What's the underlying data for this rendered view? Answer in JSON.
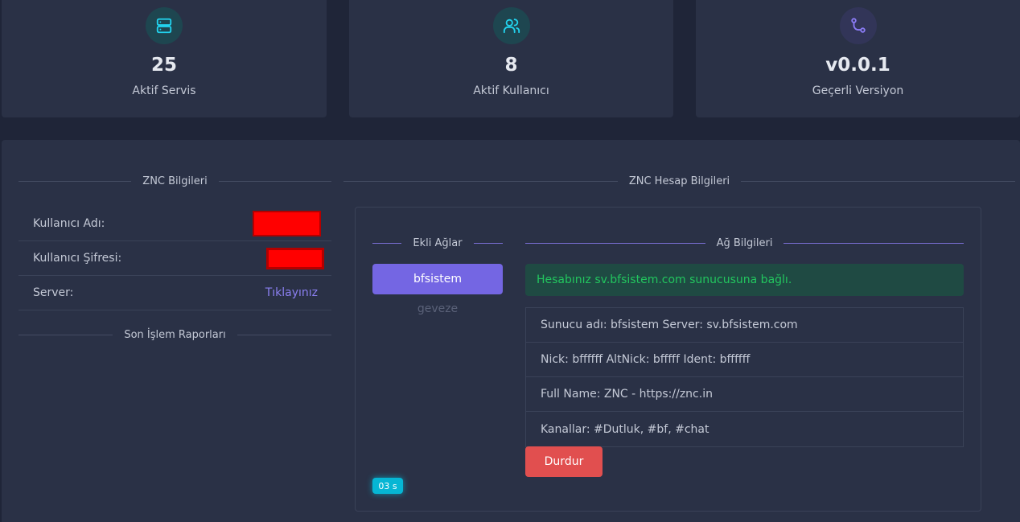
{
  "stats": [
    {
      "value": "25",
      "label": "Aktif Servis",
      "icon": "server-icon",
      "color": "#22d3ee"
    },
    {
      "value": "8",
      "label": "Aktif Kullanıcı",
      "icon": "users-icon",
      "color": "#22d3ee"
    },
    {
      "value": "v0.0.1",
      "label": "Geçerli Versiyon",
      "icon": "git-branch-icon",
      "color": "#8b7cf6"
    }
  ],
  "znc_info": {
    "title": "ZNC Bilgileri",
    "username_label": "Kullanıcı Adı:",
    "password_label": "Kullanıcı Şifresi:",
    "server_label": "Server:",
    "server_link": "Tıklayınız",
    "reports_title": "Son İşlem Raporları"
  },
  "account": {
    "title": "ZNC Hesap Bilgileri",
    "networks_title": "Ekli Ağlar",
    "network_info_title": "Ağ Bilgileri",
    "networks": [
      "bfsistem",
      "geveze"
    ],
    "alert": "Hesabınız sv.bfsistem.com sunucusuna bağlı.",
    "details": [
      "Sunucu adı: bfsistem Server: sv.bfsistem.com",
      "Nick: bffffff AltNick: bfffff Ident: bffffff",
      "Full Name: ZNC - https://znc.in",
      "Kanallar: #Dutluk, #bf, #chat"
    ],
    "stop_label": "Durdur",
    "timer": "03 s"
  }
}
